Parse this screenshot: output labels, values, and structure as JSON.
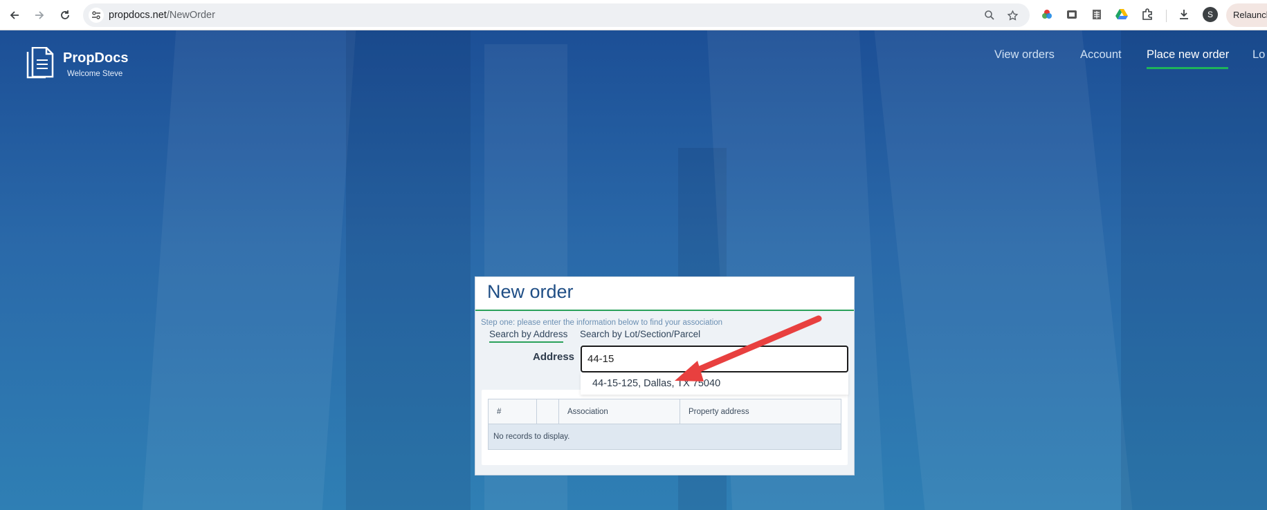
{
  "browser": {
    "url_domain": "propdocs.net",
    "url_path": "/NewOrder",
    "profile_initial": "S",
    "relaunch_label": "Relaunch",
    "icons": [
      "back-icon",
      "forward-icon",
      "reload-icon",
      "site-info-icon",
      "zoom-icon",
      "bookmark-star-icon",
      "extension-color-icon",
      "extension-web-icon",
      "extension-sheet-icon",
      "google-drive-icon",
      "extensions-puzzle-icon",
      "download-icon"
    ]
  },
  "header": {
    "brand": "PropDocs",
    "welcome": "Welcome Steve",
    "nav": [
      {
        "label": "View orders",
        "active": false
      },
      {
        "label": "Account",
        "active": false
      },
      {
        "label": "Place new order",
        "active": true
      },
      {
        "label": "Lo",
        "active": false
      }
    ]
  },
  "card": {
    "title": "New order",
    "step_text": "Step one: please enter the information below to find your association",
    "tabs": [
      {
        "label": "Search by Address",
        "active": true
      },
      {
        "label": "Search by Lot/Section/Parcel",
        "active": false
      }
    ],
    "address_label": "Address",
    "address_value": "44-15",
    "suggestion": "44-15-125, Dallas, TX 75040",
    "grid": {
      "columns": [
        "#",
        "",
        "Association",
        "Property address"
      ],
      "empty_message": "No records to display."
    }
  },
  "colors": {
    "accent_green": "#2aa15a",
    "title_blue": "#1f4e85",
    "annotation_arrow": "#e8403f"
  }
}
